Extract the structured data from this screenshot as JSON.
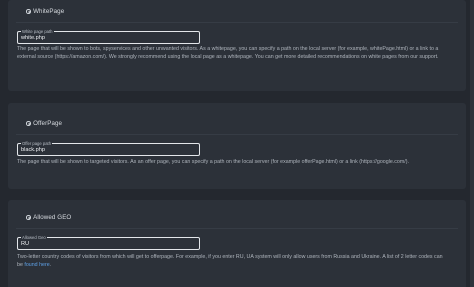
{
  "sections": [
    {
      "title": "WhitePage",
      "field_label": "White page path",
      "field_value": "white.php",
      "help_text": "The page that will be shown to bots, spyservices and other unwanted visitors. As a whitepage, you can specify a path on the local server (for example, whitePage.html) or a link to a external source (https://amazon.com/). We strongly recommend using the local page as a whitepage. You can get more detailed recommendations on white pages from our support."
    },
    {
      "title": "OfferPage",
      "field_label": "Offer page path",
      "field_value": "black.php",
      "help_text": "The page that will be shown to targeted visitors. As an offer page, you can specify a path on the local server (for example offerPage.html) or a link (https://google.com/)."
    },
    {
      "title": "Allowed GEO",
      "field_label": "Allowed Geo",
      "field_value": "RU",
      "help_text": "Two-letter country codes of visitors from which will get to offerpage. For example, if you enter RU, UA system will only allow users from Russia and Ukraine. A list of 2 letter codes can be ",
      "help_link": "found here",
      "help_suffix": "."
    }
  ],
  "icons": {
    "section_icon": "circle-check-icon"
  },
  "colors": {
    "background": "#24282f",
    "card": "#2c3139",
    "link": "#5ea0e6",
    "text": "#aeb4bc"
  }
}
